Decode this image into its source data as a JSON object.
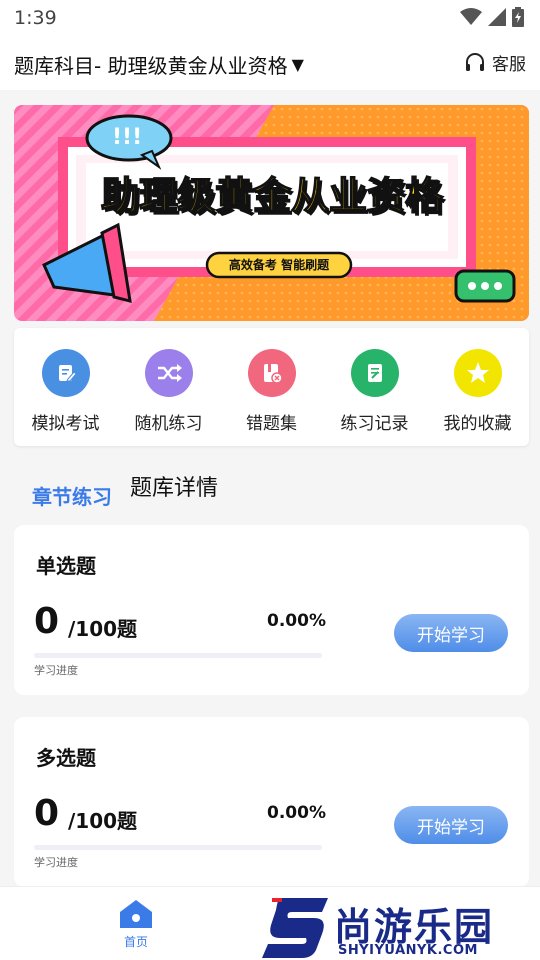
{
  "status_bar": {
    "time": "1:39"
  },
  "header": {
    "subject_label": "题库科目- 助理级黄金从业资格",
    "service_label": "客服"
  },
  "banner": {
    "title": "助理级黄金从业资格",
    "tagline": "高效备考 智能刷题"
  },
  "quick_menu": [
    {
      "label": "模拟考试",
      "icon": "exam-icon",
      "color": "#4a90e2"
    },
    {
      "label": "随机练习",
      "icon": "shuffle-icon",
      "color": "#9b7fea"
    },
    {
      "label": "错题集",
      "icon": "error-book-icon",
      "color": "#f0677e"
    },
    {
      "label": "练习记录",
      "icon": "record-icon",
      "color": "#27b36a"
    },
    {
      "label": "我的收藏",
      "icon": "star-icon",
      "color": "#f2d500"
    }
  ],
  "tabs": {
    "active": "章节练习",
    "inactive": "题库详情"
  },
  "cards": [
    {
      "title": "单选题",
      "count": "0",
      "total": "/100题",
      "percent": "0.00%",
      "progress": 0,
      "progress_label": "学习进度",
      "button": "开始学习"
    },
    {
      "title": "多选题",
      "count": "0",
      "total": "/100题",
      "percent": "0.00%",
      "progress": 0,
      "progress_label": "学习进度",
      "button": "开始学习"
    }
  ],
  "bottom_nav": {
    "home_label": "首页"
  },
  "watermark": {
    "text": "尚游乐园",
    "url": "SHYIYUANYK.COM"
  },
  "colors": {
    "accent": "#3a7be8",
    "banner_orange": "#ff9a2a",
    "banner_pink": "#ff5fa0"
  }
}
